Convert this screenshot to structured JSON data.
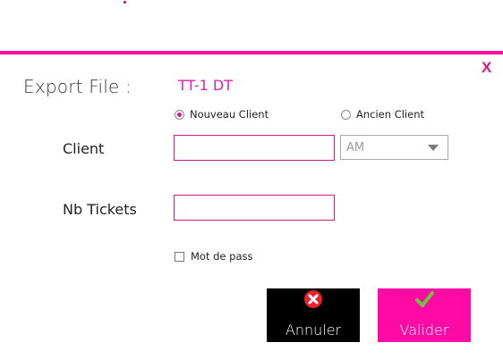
{
  "colors": {
    "accent": "#ff0aa5",
    "accent_text": "#e020b0",
    "close": "#e0148c",
    "cancel_bg": "#000000",
    "validate_bg": "#ff0aa5",
    "cancel_icon": "#e8212f",
    "validate_icon": "#6ac43c"
  },
  "dialog": {
    "close_label": "X",
    "export_label": "Export File :",
    "file_name": "TT-1 DT"
  },
  "client_type": {
    "options": [
      {
        "label": "Nouveau Client",
        "selected": true
      },
      {
        "label": "Ancien Client",
        "selected": false
      }
    ]
  },
  "form": {
    "client_label": "Client",
    "client_value": "",
    "client_select_value": "AM",
    "tickets_label": "Nb Tickets",
    "tickets_value": "",
    "password_checkbox_label": "Mot de pass",
    "password_checked": false
  },
  "buttons": {
    "cancel_label": "Annuler",
    "cancel_icon": "close-circle-icon",
    "validate_label": "Valider",
    "validate_icon": "checkmark-icon"
  }
}
